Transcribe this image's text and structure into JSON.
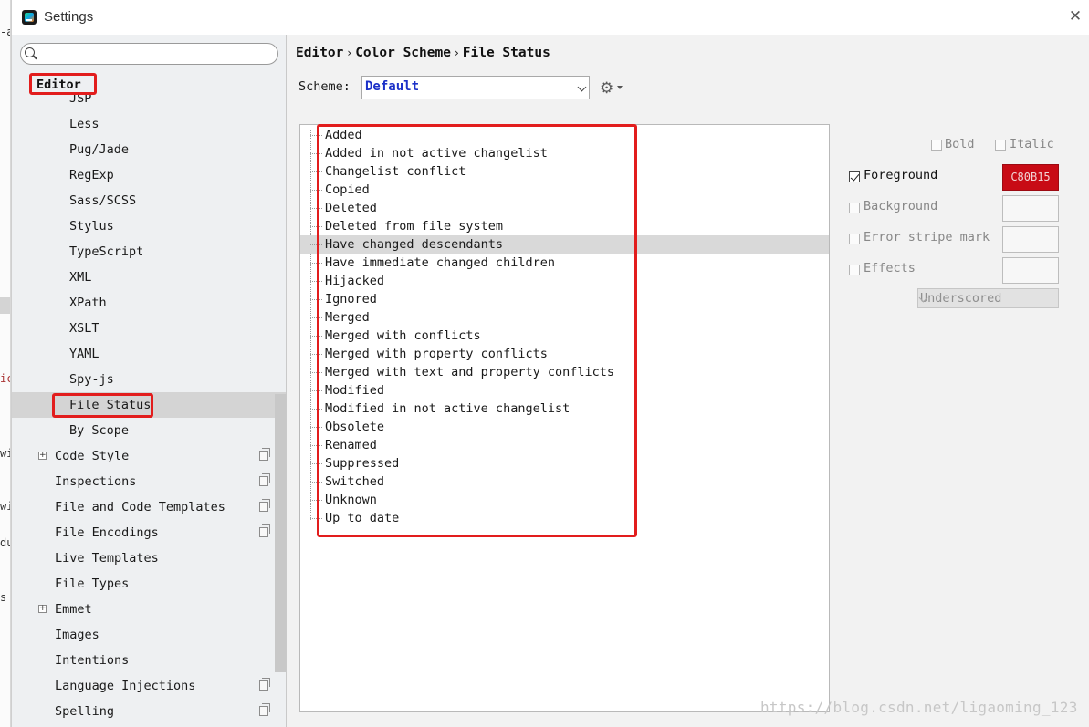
{
  "window": {
    "title": "Settings",
    "close_glyph": "✕"
  },
  "background_fragments": [
    "-a",
    "ic",
    "wi",
    "wi",
    "du",
    "s"
  ],
  "search": {
    "placeholder": "",
    "value": ""
  },
  "sidebar": {
    "section_header": "Editor",
    "items": [
      {
        "label": "JSP",
        "expandable": false,
        "copy_icon": false,
        "selected": false,
        "indent": 2
      },
      {
        "label": "Less",
        "expandable": false,
        "copy_icon": false,
        "selected": false,
        "indent": 2
      },
      {
        "label": "Pug/Jade",
        "expandable": false,
        "copy_icon": false,
        "selected": false,
        "indent": 2
      },
      {
        "label": "RegExp",
        "expandable": false,
        "copy_icon": false,
        "selected": false,
        "indent": 2
      },
      {
        "label": "Sass/SCSS",
        "expandable": false,
        "copy_icon": false,
        "selected": false,
        "indent": 2
      },
      {
        "label": "Stylus",
        "expandable": false,
        "copy_icon": false,
        "selected": false,
        "indent": 2
      },
      {
        "label": "TypeScript",
        "expandable": false,
        "copy_icon": false,
        "selected": false,
        "indent": 2
      },
      {
        "label": "XML",
        "expandable": false,
        "copy_icon": false,
        "selected": false,
        "indent": 2
      },
      {
        "label": "XPath",
        "expandable": false,
        "copy_icon": false,
        "selected": false,
        "indent": 2
      },
      {
        "label": "XSLT",
        "expandable": false,
        "copy_icon": false,
        "selected": false,
        "indent": 2
      },
      {
        "label": "YAML",
        "expandable": false,
        "copy_icon": false,
        "selected": false,
        "indent": 2
      },
      {
        "label": "Spy-js",
        "expandable": false,
        "copy_icon": false,
        "selected": false,
        "indent": 2
      },
      {
        "label": "File Status",
        "expandable": false,
        "copy_icon": false,
        "selected": true,
        "indent": 2
      },
      {
        "label": "By Scope",
        "expandable": false,
        "copy_icon": false,
        "selected": false,
        "indent": 2
      },
      {
        "label": "Code Style",
        "expandable": true,
        "copy_icon": true,
        "selected": false,
        "indent": 1
      },
      {
        "label": "Inspections",
        "expandable": false,
        "copy_icon": true,
        "selected": false,
        "indent": 1
      },
      {
        "label": "File and Code Templates",
        "expandable": false,
        "copy_icon": true,
        "selected": false,
        "indent": 1
      },
      {
        "label": "File Encodings",
        "expandable": false,
        "copy_icon": true,
        "selected": false,
        "indent": 1
      },
      {
        "label": "Live Templates",
        "expandable": false,
        "copy_icon": false,
        "selected": false,
        "indent": 1
      },
      {
        "label": "File Types",
        "expandable": false,
        "copy_icon": false,
        "selected": false,
        "indent": 1
      },
      {
        "label": "Emmet",
        "expandable": true,
        "copy_icon": false,
        "selected": false,
        "indent": 1
      },
      {
        "label": "Images",
        "expandable": false,
        "copy_icon": false,
        "selected": false,
        "indent": 1
      },
      {
        "label": "Intentions",
        "expandable": false,
        "copy_icon": false,
        "selected": false,
        "indent": 1
      },
      {
        "label": "Language Injections",
        "expandable": false,
        "copy_icon": true,
        "selected": false,
        "indent": 1
      },
      {
        "label": "Spelling",
        "expandable": false,
        "copy_icon": true,
        "selected": false,
        "indent": 1
      }
    ]
  },
  "breadcrumb": {
    "parts": [
      "Editor",
      "Color Scheme",
      "File Status"
    ],
    "separator": "›"
  },
  "scheme": {
    "label": "Scheme:",
    "value": "Default"
  },
  "file_status_list": {
    "selected_index": 6,
    "items": [
      "Added",
      "Added in not active changelist",
      "Changelist conflict",
      "Copied",
      "Deleted",
      "Deleted from file system",
      "Have changed descendants",
      "Have immediate changed children",
      "Hijacked",
      "Ignored",
      "Merged",
      "Merged with conflicts",
      "Merged with property conflicts",
      "Merged with text and property conflicts",
      "Modified",
      "Modified in not active changelist",
      "Obsolete",
      "Renamed",
      "Suppressed",
      "Switched",
      "Unknown",
      "Up to date"
    ]
  },
  "attributes": {
    "bold_label": "Bold",
    "italic_label": "Italic",
    "foreground_label": "Foreground",
    "foreground_checked": true,
    "foreground_value": "C80B15",
    "foreground_color": "#C80B15",
    "background_label": "Background",
    "error_stripe_label": "Error stripe mark",
    "effects_label": "Effects",
    "effect_type": "Underscored"
  },
  "colors": {
    "annotation_red": "#E21D1D",
    "scheme_value_blue": "#1C31C8",
    "selection_gray": "#D4D4D4"
  },
  "watermark": "https://blog.csdn.net/ligaoming_123"
}
